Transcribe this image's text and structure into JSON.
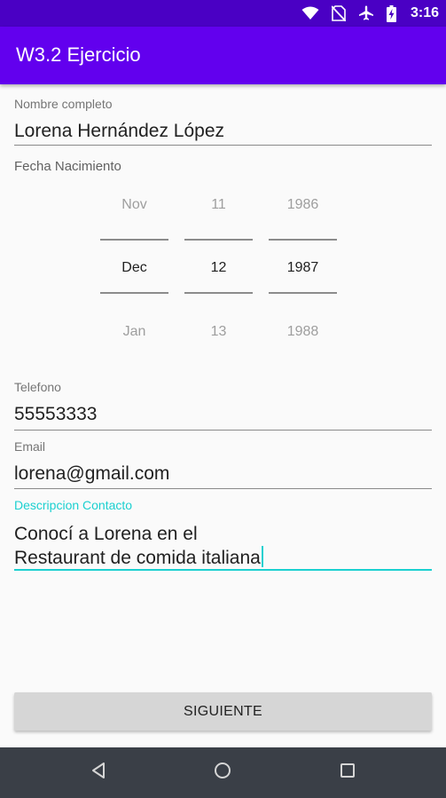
{
  "status_bar": {
    "time": "3:16",
    "icons": [
      "wifi-icon",
      "no-sim-icon",
      "airplane-icon",
      "battery-charging-icon"
    ]
  },
  "app_bar": {
    "title": "W3.2 Ejercicio",
    "color": "#6200ee"
  },
  "form": {
    "name": {
      "label": "Nombre completo",
      "value": "Lorena Hernández López"
    },
    "birth_date": {
      "label": "Fecha Nacimiento",
      "month": {
        "prev": "Nov",
        "selected": "Dec",
        "next": "Jan"
      },
      "day": {
        "prev": "11",
        "selected": "12",
        "next": "13"
      },
      "year": {
        "prev": "1986",
        "selected": "1987",
        "next": "1988"
      }
    },
    "phone": {
      "label": "Telefono",
      "value": "55553333"
    },
    "email": {
      "label": "Email",
      "value": "lorena@gmail.com"
    },
    "description": {
      "label": "Descripcion Contacto",
      "line1": "Conocí a Lorena en el",
      "line2": "Restaurant de comida italiana",
      "accent_color": "#1bd0d0"
    }
  },
  "actions": {
    "next_label": "SIGUIENTE"
  },
  "nav_bar": {
    "icons": [
      "back-icon",
      "home-icon",
      "recents-icon"
    ]
  }
}
